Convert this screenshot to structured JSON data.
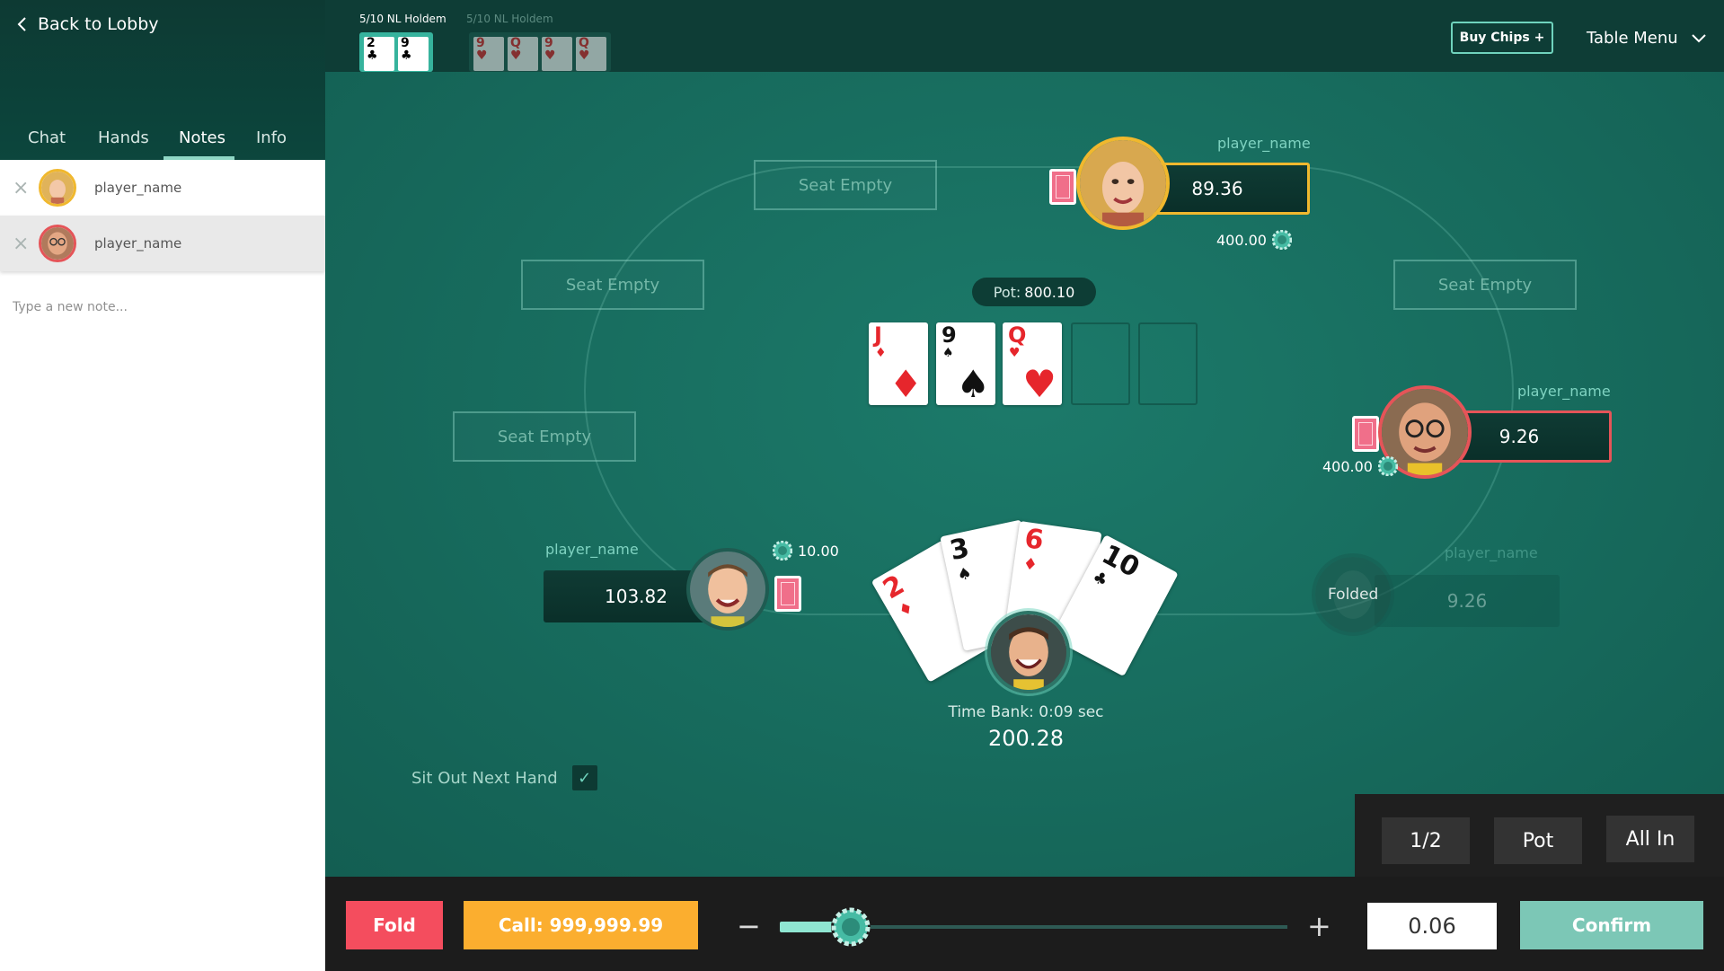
{
  "colors": {
    "felt": "#176b5d",
    "accent": "#6fd3bd",
    "fold": "#f44d5e",
    "call": "#fbae2f",
    "confirm": "#7cc7b6",
    "active_gold": "#f0b82e",
    "active_red": "#e55458"
  },
  "sidebar": {
    "back_label": "Back to Lobby",
    "tabs": [
      {
        "label": "Chat"
      },
      {
        "label": "Hands"
      },
      {
        "label": "Notes",
        "active": true
      },
      {
        "label": "Info"
      }
    ],
    "notes": [
      {
        "name": "player_name",
        "avatar": "avatar-blonde-woman",
        "ring": "gold"
      },
      {
        "name": "player_name",
        "avatar": "avatar-bald-man-glasses",
        "ring": "red"
      }
    ],
    "note_placeholder": "Type a new note..."
  },
  "topbar": {
    "tables": [
      {
        "label": "5/10 NL Holdem",
        "active": true,
        "cards": [
          {
            "rank": "2",
            "suit": "♣",
            "color": "black"
          },
          {
            "rank": "9",
            "suit": "♣",
            "color": "black"
          }
        ]
      },
      {
        "label": "5/10 NL Holdem",
        "active": false,
        "cards": [
          {
            "rank": "9",
            "suit": "♥",
            "color": "red"
          },
          {
            "rank": "Q",
            "suit": "♥",
            "color": "red"
          },
          {
            "rank": "9",
            "suit": "♥",
            "color": "red"
          },
          {
            "rank": "Q",
            "suit": "♥",
            "color": "red"
          }
        ]
      }
    ],
    "buy_chips": "Buy Chips +",
    "table_menu": "Table Menu"
  },
  "table": {
    "empty_seat_label": "Seat Empty",
    "pot_label": "Pot:",
    "pot_value": "800.10",
    "board": [
      {
        "rank": "J",
        "suit": "♦",
        "color": "red"
      },
      {
        "rank": "9",
        "suit": "♠",
        "color": "black"
      },
      {
        "rank": "Q",
        "suit": "♥",
        "color": "red"
      }
    ],
    "players": {
      "top": {
        "name": "player_name",
        "stack": "89.36",
        "bet": "400.00"
      },
      "right": {
        "name": "player_name",
        "stack": "9.26",
        "bet": "400.00"
      },
      "left": {
        "name": "player_name",
        "stack": "103.82",
        "bet": "10.00"
      },
      "folded": {
        "name": "player_name",
        "stack": "9.26",
        "status": "Folded"
      }
    },
    "hero": {
      "cards": [
        {
          "rank": "2",
          "suit": "♦",
          "color": "red"
        },
        {
          "rank": "3",
          "suit": "♠",
          "color": "black"
        },
        {
          "rank": "6",
          "suit": "♦",
          "color": "red"
        },
        {
          "rank": "10",
          "suit": "♣",
          "color": "black"
        }
      ],
      "time_bank": "Time Bank: 0:09 sec",
      "stack": "200.28"
    },
    "sit_out_label": "Sit Out Next Hand",
    "sit_out_checked": true
  },
  "presets": [
    {
      "label": "1/2"
    },
    {
      "label": "Pot"
    },
    {
      "label": "All In"
    }
  ],
  "actions": {
    "fold": "Fold",
    "call": "Call: 999,999.99",
    "minus": "−",
    "plus": "+",
    "amount": "0.06",
    "confirm": "Confirm",
    "slider_fraction": 0.14
  }
}
